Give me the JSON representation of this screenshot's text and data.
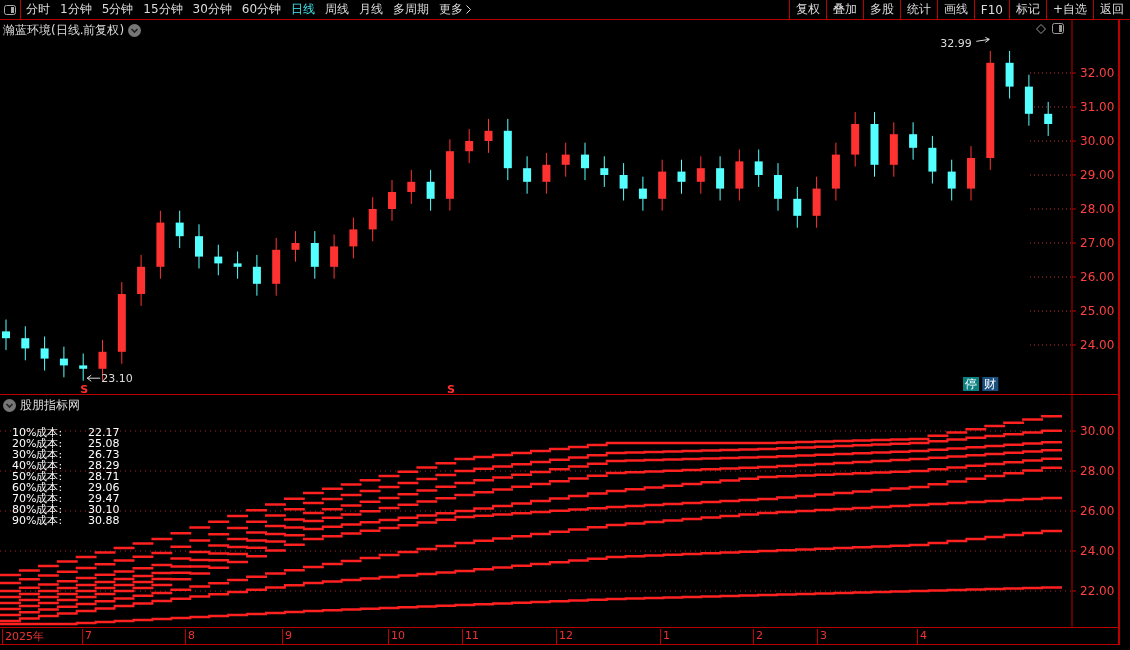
{
  "toolbar": {
    "periods": [
      {
        "label": "分时",
        "selected": false
      },
      {
        "label": "1分钟",
        "selected": false
      },
      {
        "label": "5分钟",
        "selected": false
      },
      {
        "label": "15分钟",
        "selected": false
      },
      {
        "label": "30分钟",
        "selected": false
      },
      {
        "label": "60分钟",
        "selected": false
      },
      {
        "label": "日线",
        "selected": true
      },
      {
        "label": "周线",
        "selected": false
      },
      {
        "label": "月线",
        "selected": false
      },
      {
        "label": "多周期",
        "selected": false
      },
      {
        "label": "更多",
        "selected": false
      }
    ],
    "buttons": [
      "复权",
      "叠加",
      "多股",
      "统计",
      "画线",
      "F10",
      "标记",
      "+自选",
      "返回"
    ]
  },
  "main_chart": {
    "title": "瀚蓝环境(日线.前复权)",
    "price_axis": [
      "32.00",
      "31.00",
      "30.00",
      "29.00",
      "28.00",
      "27.00",
      "26.00",
      "25.00",
      "24.00"
    ],
    "high_label": "32.99",
    "low_label": "23.10",
    "markers": [
      {
        "kind": "signal",
        "text": "S"
      },
      {
        "kind": "signal",
        "text": "S"
      },
      {
        "kind": "badge",
        "text": "停",
        "color": "#0a8080"
      },
      {
        "kind": "badge",
        "text": "财",
        "color": "#1a4f80"
      }
    ]
  },
  "indicator": {
    "title": "股朋指标网",
    "legend": [
      {
        "label": "10%成本:",
        "value": "22.17"
      },
      {
        "label": "20%成本:",
        "value": "25.08"
      },
      {
        "label": "30%成本:",
        "value": "26.73"
      },
      {
        "label": "40%成本:",
        "value": "28.29"
      },
      {
        "label": "50%成本:",
        "value": "28.71"
      },
      {
        "label": "60%成本:",
        "value": "29.06"
      },
      {
        "label": "70%成本:",
        "value": "29.47"
      },
      {
        "label": "80%成本:",
        "value": "30.10"
      },
      {
        "label": "90%成本:",
        "value": "30.88"
      }
    ],
    "axis": [
      "30.00",
      "28.00",
      "26.00",
      "24.00",
      "22.00"
    ]
  },
  "date_axis": {
    "labels": [
      "2025年",
      "7",
      "8",
      "9",
      "10",
      "11",
      "12",
      "1",
      "2",
      "3",
      "4"
    ]
  }
}
